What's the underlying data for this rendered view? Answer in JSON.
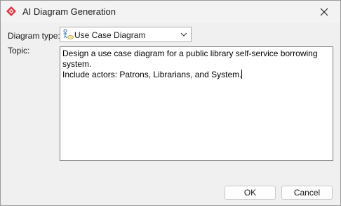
{
  "window": {
    "title": "AI Diagram Generation",
    "icon": "app-logo-icon",
    "close_icon": "close-icon"
  },
  "form": {
    "diagram_type_label": "Diagram type:",
    "diagram_type_value": "Use Case Diagram",
    "diagram_type_icon": "use-case-diagram-icon",
    "topic_label": "Topic:",
    "topic_value": "Design a use case diagram for a public library self-service borrowing system.\nInclude actors: Patrons, Librarians, and System."
  },
  "buttons": {
    "ok_label": "OK",
    "cancel_label": "Cancel"
  },
  "colors": {
    "accent": "#d9363e",
    "window_bg": "#f0f0f0"
  }
}
